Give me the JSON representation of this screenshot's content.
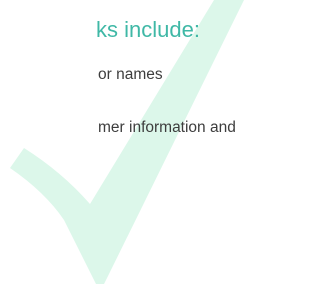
{
  "heading": {
    "text": "ks include:",
    "color": "#3fb8a6"
  },
  "lines": [
    {
      "text": "or names"
    },
    {
      "text": "mer information and"
    }
  ],
  "text_color": "#3d3d3d",
  "checkmark": {
    "icon": "checkmark-icon",
    "color": "#dcf7ea"
  }
}
